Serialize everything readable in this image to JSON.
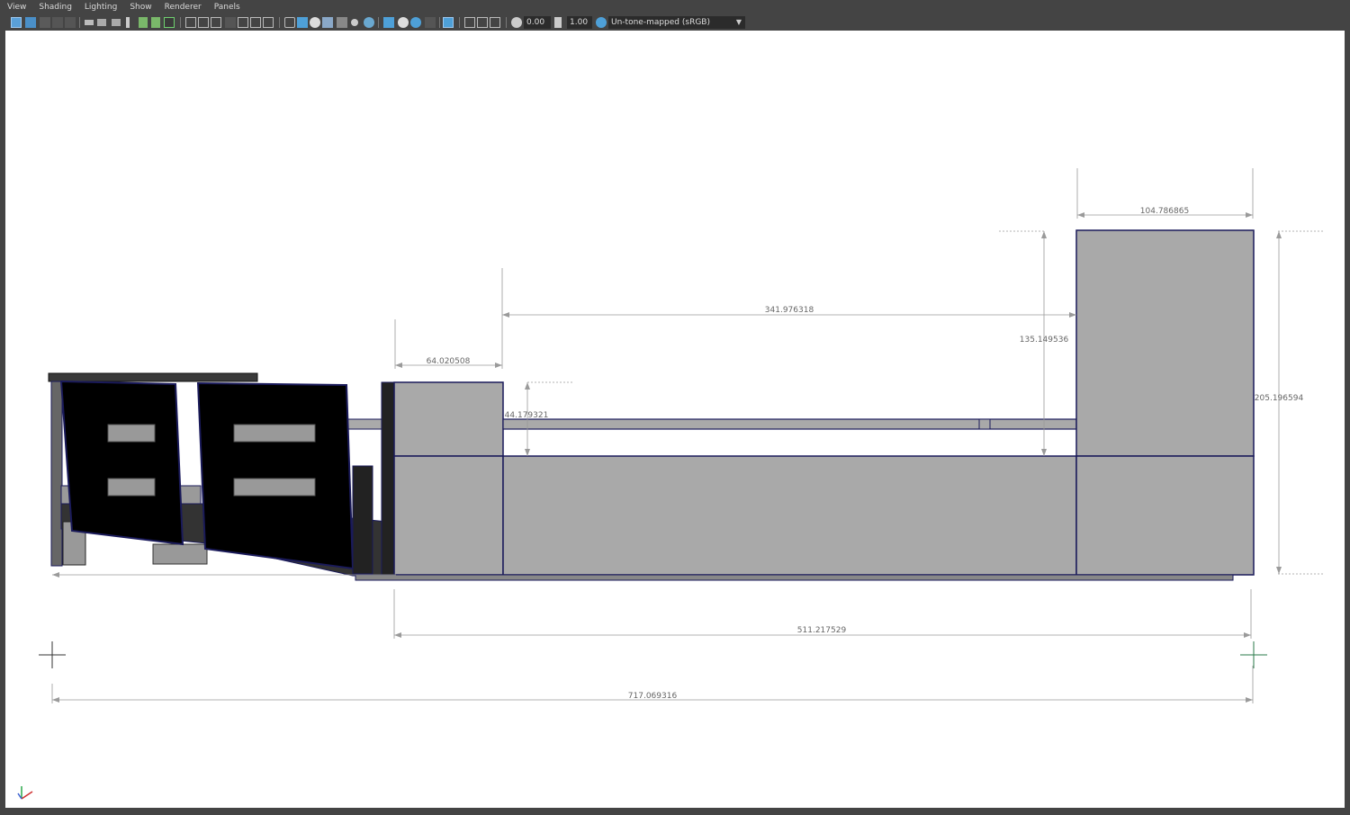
{
  "menus": [
    "View",
    "Shading",
    "Lighting",
    "Show",
    "Renderer",
    "Panels"
  ],
  "toolbar": {
    "exposure_value": "0.00",
    "gamma_value": "1.00",
    "color_space": "Un-tone-mapped (sRGB)",
    "icons": [
      "select-camera-icon",
      "camera-attributes-icon",
      "bookmark-icon",
      "image-plane-icon",
      "grid-icon",
      "film-gate-icon",
      "resolution-gate-icon",
      "gate-mask-icon",
      "field-chart-icon",
      "safe-action-icon",
      "safe-title-icon",
      "wireframe-icon",
      "smooth-shade-icon",
      "default-material-icon",
      "textured-icon",
      "use-all-lights-icon",
      "shadows-icon",
      "screen-space-ao-icon",
      "motion-blur-icon",
      "anti-aliasing-icon",
      "isolate-select-icon",
      "xray-icon",
      "xray-joints-icon",
      "backface-culling-icon",
      "exposure-icon",
      "gamma-icon",
      "color-management-icon"
    ]
  },
  "dimensions": [
    {
      "id": "dim-top-right-width",
      "value": "104.786865"
    },
    {
      "id": "dim-center-span",
      "value": "341.976318"
    },
    {
      "id": "dim-right-inner-height",
      "value": "135.149536"
    },
    {
      "id": "dim-right-total-height",
      "value": "205.196594"
    },
    {
      "id": "dim-left-block-width",
      "value": "64.020508"
    },
    {
      "id": "dim-left-block-height",
      "value": "44.179321"
    },
    {
      "id": "dim-counter-length",
      "value": "511.217529"
    },
    {
      "id": "dim-overall-length",
      "value": "717.069316"
    }
  ],
  "colors": {
    "viewport_bg": "#ffffff",
    "panel_fill": "#a9a9a9",
    "edge_outline": "#1a1a5a",
    "door_fill": "#000000",
    "dimension_line": "#9a9a9a"
  }
}
